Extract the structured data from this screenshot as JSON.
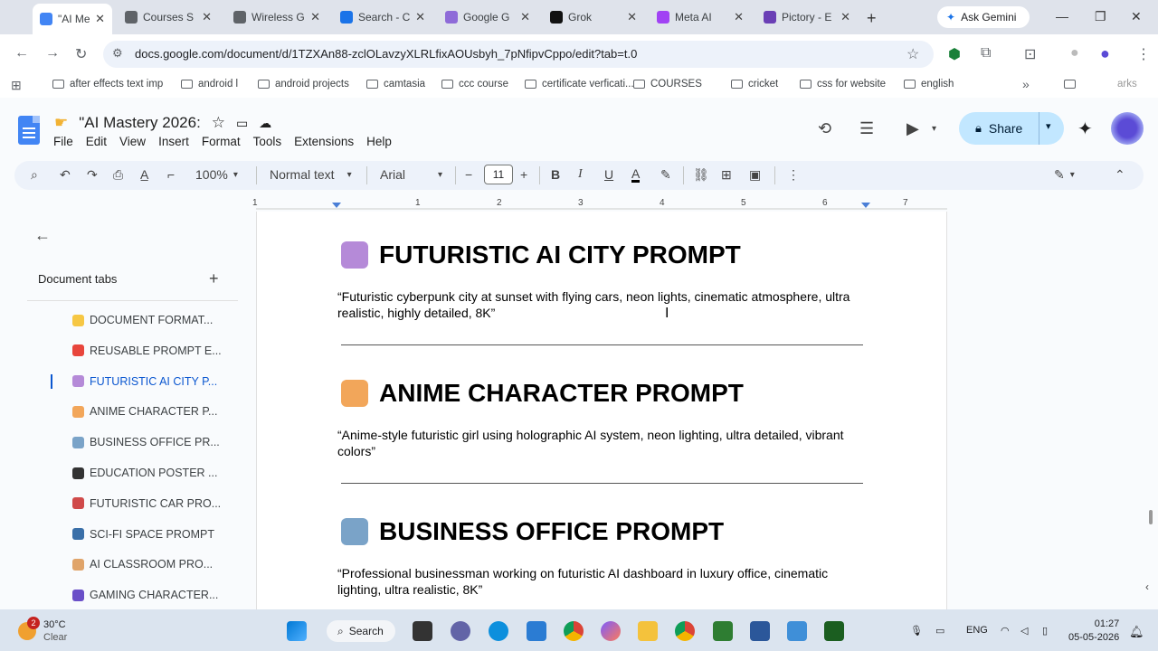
{
  "browser": {
    "tabs": [
      {
        "title": "\"AI Me",
        "fav": "#4285f4",
        "active": true
      },
      {
        "title": "Courses S",
        "fav": "#5f6368"
      },
      {
        "title": "Wireless G",
        "fav": "#5f6368"
      },
      {
        "title": "Search - C",
        "fav": "#1a73e8"
      },
      {
        "title": "Google G",
        "fav": "#8e6bd8"
      },
      {
        "title": "Grok",
        "fav": "#111111"
      },
      {
        "title": "Meta AI",
        "fav": "#a142f4"
      },
      {
        "title": "Pictory - E",
        "fav": "#6a3fb5"
      }
    ],
    "ask_gemini": "Ask Gemini",
    "url": "docs.google.com/document/d/1TZXAn88-zclOLavzyXLRLfixAOUsbyh_7pNfipvCppo/edit?tab=t.0",
    "bookmarks": [
      "after effects text imp",
      "android l",
      "android projects",
      "camtasia",
      "ccc course",
      "certificate verficati...",
      "COURSES",
      "cricket",
      "css for website",
      "english"
    ],
    "bookmarks_more": "arks"
  },
  "docs": {
    "title": "\"AI Mastery 2026:",
    "menu": [
      "File",
      "Edit",
      "View",
      "Insert",
      "Format",
      "Tools",
      "Extensions",
      "Help"
    ],
    "share_label": "Share",
    "toolbar": {
      "zoom": "100%",
      "style": "Normal text",
      "font": "Arial",
      "font_size": "11"
    },
    "ruler": [
      "1",
      "1",
      "2",
      "3",
      "4",
      "5",
      "6",
      "7"
    ]
  },
  "sidebar": {
    "heading": "Document tabs",
    "items": [
      {
        "label": "DOCUMENT FORMAT...",
        "color": "#f6c744"
      },
      {
        "label": "REUSABLE PROMPT E...",
        "color": "#e8453c"
      },
      {
        "label": "FUTURISTIC AI CITY P...",
        "color": "#b58ad8",
        "selected": true
      },
      {
        "label": "ANIME CHARACTER P...",
        "color": "#f2a65a"
      },
      {
        "label": "BUSINESS OFFICE PR...",
        "color": "#7aa3c8"
      },
      {
        "label": "EDUCATION POSTER ...",
        "color": "#333333"
      },
      {
        "label": "FUTURISTIC CAR PRO...",
        "color": "#d04a4a"
      },
      {
        "label": "SCI-FI SPACE PROMPT",
        "color": "#3a6fa8"
      },
      {
        "label": "AI CLASSROOM PRO...",
        "color": "#e0a46a"
      },
      {
        "label": "GAMING CHARACTER...",
        "color": "#6a4fc8"
      }
    ]
  },
  "content": {
    "sections": [
      {
        "heading": "FUTURISTIC AI CITY PROMPT",
        "emoji_color": "#b58ad8",
        "text": "“Futuristic cyberpunk city at sunset with flying cars, neon lights, cinematic atmosphere, ultra realistic, highly detailed, 8K”"
      },
      {
        "heading": "ANIME CHARACTER PROMPT",
        "emoji_color": "#f2a65a",
        "text": "“Anime-style futuristic girl using holographic AI system, neon lighting, ultra detailed, vibrant colors”"
      },
      {
        "heading": "BUSINESS OFFICE PROMPT",
        "emoji_color": "#7aa3c8",
        "text": "“Professional businessman working on futuristic AI dashboard in luxury office, cinematic lighting, ultra realistic, 8K”"
      }
    ]
  },
  "taskbar": {
    "weather_temp": "30°C",
    "weather_desc": "Clear",
    "weather_badge": "2",
    "search_label": "Search",
    "lang": "ENG",
    "time": "01:27",
    "date": "05-05-2026"
  }
}
